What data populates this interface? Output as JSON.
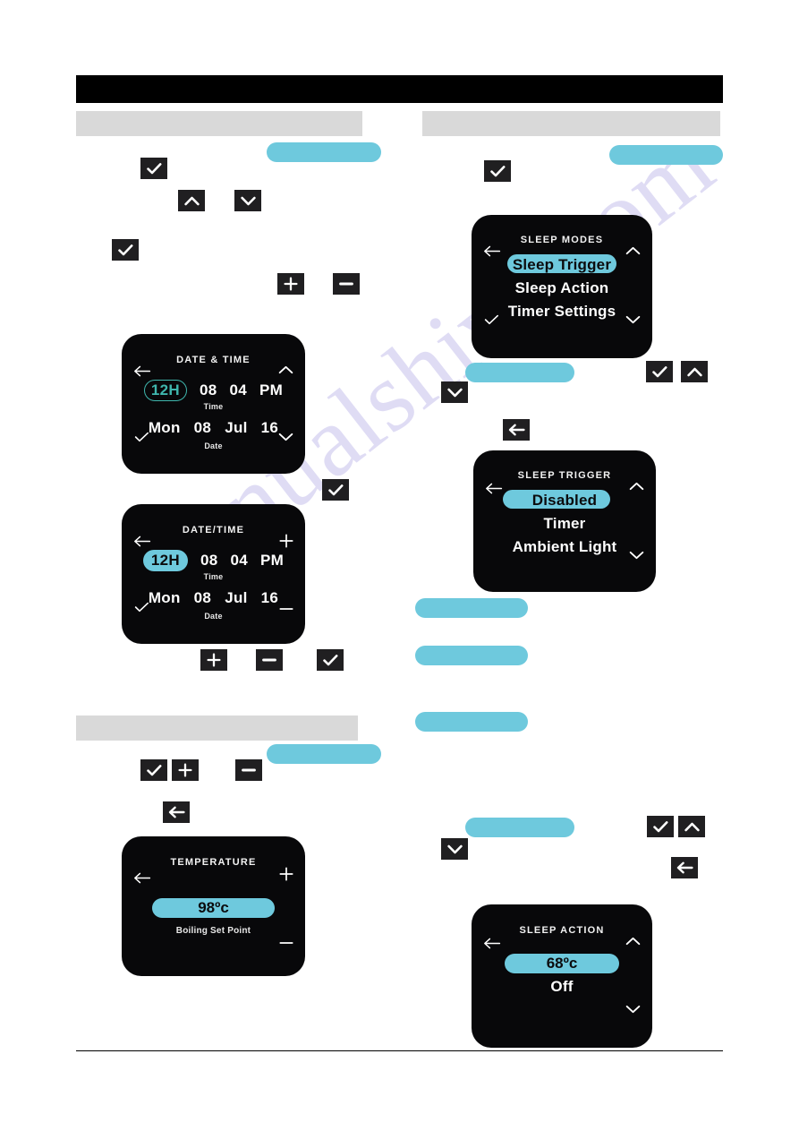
{
  "document": {
    "title_banner_text": "",
    "watermark_text": "manualshive.com"
  },
  "sections": [
    {
      "name": "left-section-1-header",
      "text": ""
    },
    {
      "name": "right-section-1-header",
      "text": ""
    },
    {
      "name": "left-section-2-header",
      "text": ""
    }
  ],
  "icons": {
    "check": "check-icon",
    "chevron_up": "chevron-up-icon",
    "chevron_down": "chevron-down-icon",
    "plus": "plus-icon",
    "minus": "minus-icon",
    "back_arrow": "back-arrow-icon"
  },
  "colors": {
    "accent_cyan": "#6ec9dd",
    "accent_teal_outline": "#3fb6ad",
    "screen_background": "#08080a",
    "section_bar_gray": "#d9d9d9",
    "icon_button": "#201f21",
    "banner_black": "#000000",
    "watermark_purple": "#b9b3e8"
  },
  "screens": [
    {
      "id": "date-and-time",
      "title": "DATE & TIME",
      "nav": {
        "left": "back-arrow-icon",
        "top_right": "chevron-up-icon",
        "bottom_left": "check-icon",
        "bottom_right": "chevron-down-icon"
      },
      "rows": [
        {
          "label": "Time",
          "cells": [
            {
              "text": "12H",
              "style": "outline-pill"
            },
            {
              "text": "08",
              "style": "plain"
            },
            {
              "text": "04",
              "style": "plain"
            },
            {
              "text": "PM",
              "style": "plain"
            }
          ]
        },
        {
          "label": "Date",
          "cells": [
            {
              "text": "Mon",
              "style": "plain"
            },
            {
              "text": "08",
              "style": "plain"
            },
            {
              "text": "Jul",
              "style": "plain"
            },
            {
              "text": "16",
              "style": "plain"
            }
          ]
        }
      ]
    },
    {
      "id": "date-slash-time",
      "title": "DATE/TIME",
      "nav": {
        "left": "back-arrow-icon",
        "top_right": "plus-icon",
        "bottom_left": "check-icon",
        "bottom_right": "minus-icon"
      },
      "rows": [
        {
          "label": "Time",
          "cells": [
            {
              "text": "12H",
              "style": "filled-pill"
            },
            {
              "text": "08",
              "style": "plain"
            },
            {
              "text": "04",
              "style": "plain"
            },
            {
              "text": "PM",
              "style": "plain"
            }
          ]
        },
        {
          "label": "Date",
          "cells": [
            {
              "text": "Mon",
              "style": "plain"
            },
            {
              "text": "08",
              "style": "plain"
            },
            {
              "text": "Jul",
              "style": "plain"
            },
            {
              "text": "16",
              "style": "plain"
            }
          ]
        }
      ]
    },
    {
      "id": "temperature",
      "title": "TEMPERATURE",
      "nav": {
        "left": "back-arrow-icon",
        "top_right": "plus-icon",
        "bottom_right": "minus-icon"
      },
      "value": "98ºc",
      "value_label": "Boiling Set Point"
    },
    {
      "id": "sleep-modes",
      "title": "SLEEP MODES",
      "nav": {
        "left": "back-arrow-icon",
        "top_right": "chevron-up-icon",
        "bottom_left": "check-icon",
        "bottom_right": "chevron-down-icon"
      },
      "items": [
        {
          "label": "Sleep Trigger",
          "selected": true
        },
        {
          "label": "Sleep Action",
          "selected": false
        },
        {
          "label": "Timer Settings",
          "selected": false
        }
      ]
    },
    {
      "id": "sleep-trigger",
      "title": "SLEEP TRIGGER",
      "nav": {
        "left": "back-arrow-icon",
        "top_right": "chevron-up-icon",
        "bottom_right": "chevron-down-icon"
      },
      "items": [
        {
          "label": "Disabled",
          "selected": true
        },
        {
          "label": "Timer",
          "selected": false
        },
        {
          "label": "Ambient Light",
          "selected": false
        }
      ]
    },
    {
      "id": "sleep-action",
      "title": "SLEEP ACTION",
      "nav": {
        "left": "back-arrow-icon",
        "top_right": "chevron-up-icon",
        "bottom_right": "chevron-down-icon"
      },
      "items": [
        {
          "label": "68ºc",
          "selected": true
        },
        {
          "label": "Off",
          "selected": false
        }
      ]
    }
  ]
}
